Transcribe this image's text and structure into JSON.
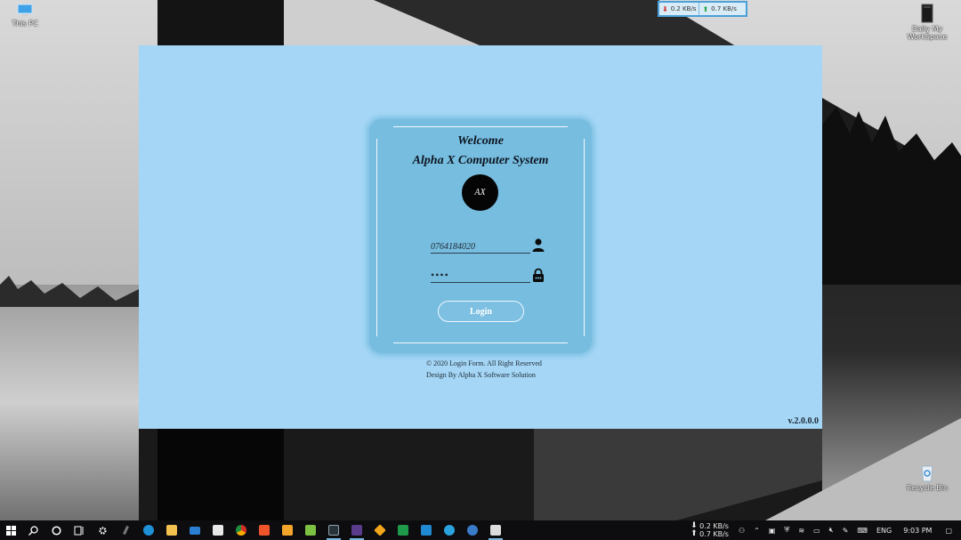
{
  "desktop": {
    "icons": [
      {
        "name": "this-pc",
        "label": "This PC",
        "icon": "monitor-icon"
      },
      {
        "name": "workspace",
        "label": "Daily My WorkSpace",
        "icon": "folder-dark-icon"
      },
      {
        "name": "recycle-bin",
        "label": "Recycle Bin",
        "icon": "recycle-bin-icon"
      }
    ]
  },
  "net_widget": {
    "down": "0.2 KB/s",
    "up": "0.7 KB/s",
    "down_color": "#d23b3b",
    "up_color": "#2aa84a"
  },
  "app": {
    "background": "#a5d6f5",
    "card_color": "#77bde0",
    "welcome": "Welcome",
    "system_name": "Alpha X Computer System",
    "logo_text": "AX",
    "username_value": "0764184020",
    "password_value": "••••",
    "login_label": "Login",
    "copyright": "© 2020 Login Form. All Right Reserved",
    "design_by": "Design By Alpha X Software Solution",
    "version": "v.2.0.0.0"
  },
  "taskbar": {
    "apps": [
      "start-icon",
      "search-icon",
      "cortana-icon",
      "task-view-icon",
      "settings-icon",
      "pen-icon",
      "edge-icon",
      "file-explorer-icon",
      "mail-icon",
      "store-icon",
      "chrome-icon",
      "brave-icon",
      "vlc-icon",
      "notepad-icon",
      "terminal-icon",
      "app-icon",
      "app-orange-icon",
      "excel-icon",
      "vscode-icon",
      "telegram-icon",
      "app-blue-icon",
      "login-app-icon"
    ],
    "net_down": "0.2 KB/s",
    "net_up": "0.7 KB/s",
    "language": "ENG",
    "time": "9:03 PM"
  }
}
